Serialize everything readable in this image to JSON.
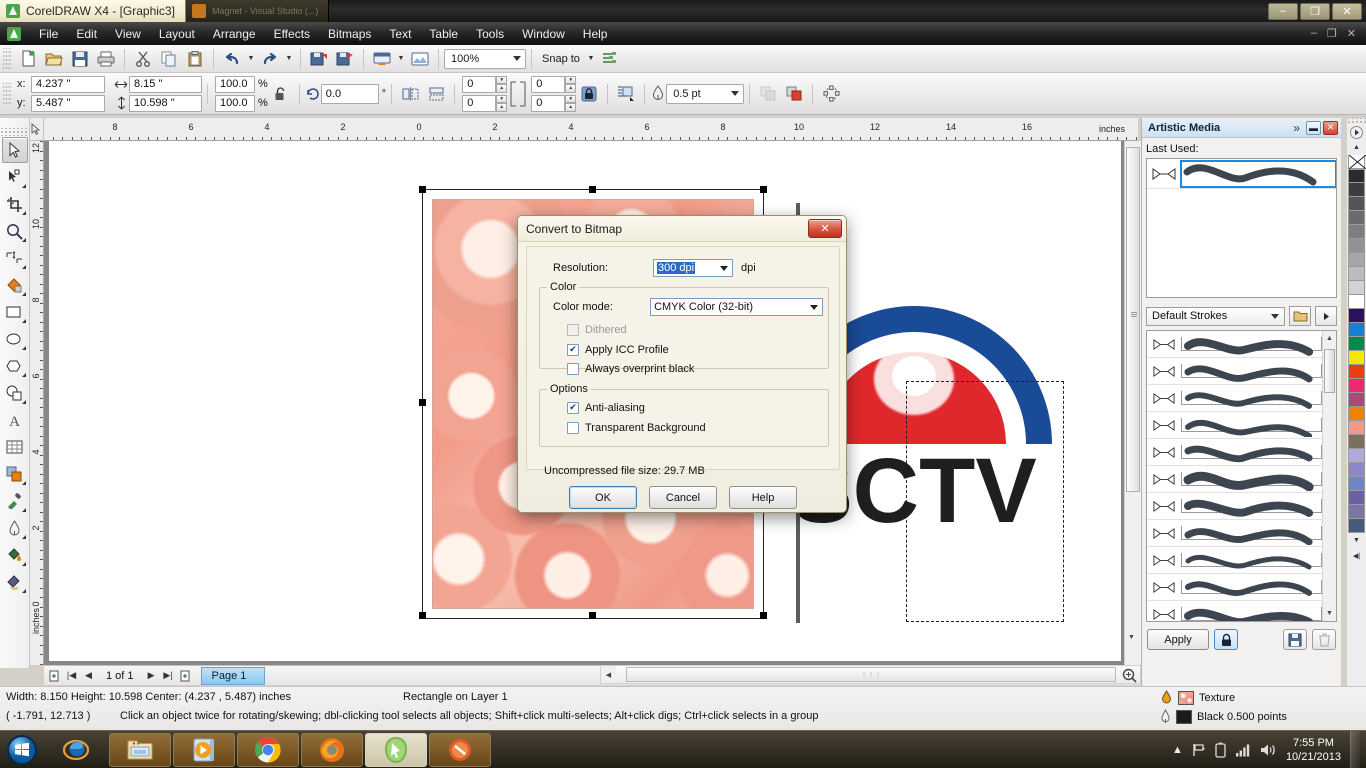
{
  "window": {
    "title": "CorelDRAW X4 - [Graphic3]",
    "ghost_tab": "Magnet - Visual Studio (...)",
    "minimize": "–",
    "restore": "❐",
    "close": "✕",
    "inner_minimize": "–",
    "inner_restore": "❐",
    "inner_close": "✕"
  },
  "menu": {
    "items": [
      {
        "label": "File"
      },
      {
        "label": "Edit"
      },
      {
        "label": "View"
      },
      {
        "label": "Layout"
      },
      {
        "label": "Arrange"
      },
      {
        "label": "Effects"
      },
      {
        "label": "Bitmaps"
      },
      {
        "label": "Text"
      },
      {
        "label": "Table"
      },
      {
        "label": "Tools"
      },
      {
        "label": "Window"
      },
      {
        "label": "Help"
      }
    ]
  },
  "toolbar": {
    "buttons": [
      "new-icon",
      "open-icon",
      "save-icon",
      "print-icon",
      "cut-icon",
      "copy-icon",
      "paste-icon",
      "undo-icon",
      "redo-icon",
      "import-icon",
      "export-icon",
      "application-launcher-icon",
      "corel-connect-icon"
    ],
    "zoom_level": "100%",
    "snap_to": "Snap to",
    "options_icon": "options-icon"
  },
  "propertybar": {
    "x_label": "x:",
    "y_label": "y:",
    "x_value": "4.237 \"",
    "y_value": "5.487 \"",
    "width_value": "8.15 \"",
    "height_value": "10.598 \"",
    "scale_h": "100.0",
    "scale_v": "100.0",
    "percent": "%",
    "lock_ratio_icon": "lock-open-icon",
    "rotation": "0.0",
    "degree": "°",
    "mirror_h_icon": "mirror-horizontal-icon",
    "mirror_v_icon": "mirror-vertical-icon",
    "corner_tl": "0",
    "corner_bl": "0",
    "corner_tr": "0",
    "corner_br": "0",
    "corner_lock_icon": "lock-closed-icon",
    "wrap_icon": "text-wrap-icon",
    "outline_width": "0.5 pt",
    "to_curves_icon": "convert-to-curves-icon"
  },
  "rulers": {
    "unit": "inches",
    "h_ticks": [
      "8",
      "6",
      "4",
      "2",
      "0",
      "2",
      "4",
      "6",
      "8",
      "10",
      "12",
      "14",
      "16"
    ],
    "v_ticks": [
      "12",
      "10",
      "8",
      "6",
      "4",
      "2",
      "0"
    ]
  },
  "toolbox": {
    "tools": [
      {
        "name": "pick-tool",
        "active": true
      },
      {
        "name": "shape-tool",
        "active": false
      },
      {
        "name": "crop-tool",
        "active": false
      },
      {
        "name": "zoom-tool",
        "active": false
      },
      {
        "name": "freehand-tool",
        "active": false
      },
      {
        "name": "smart-fill-tool",
        "active": false
      },
      {
        "name": "rectangle-tool",
        "active": false
      },
      {
        "name": "ellipse-tool",
        "active": false
      },
      {
        "name": "polygon-tool",
        "active": false
      },
      {
        "name": "basic-shapes-tool",
        "active": false
      },
      {
        "name": "text-tool",
        "active": false
      },
      {
        "name": "table-tool",
        "active": false
      },
      {
        "name": "blend-tool",
        "active": false
      },
      {
        "name": "eyedropper-tool",
        "active": false
      },
      {
        "name": "outline-tool",
        "active": false
      },
      {
        "name": "fill-tool",
        "active": false
      },
      {
        "name": "interactive-fill-tool",
        "active": false
      }
    ]
  },
  "docker": {
    "title": "Artistic Media",
    "collapse_icon": "chevrons-right-icon",
    "minimize_icon": "minimize-icon",
    "close_icon": "close-icon",
    "last_used_label": "Last Used:",
    "preset_category": "Default Strokes",
    "folder_icon": "folder-icon",
    "flyout_icon": "flyout-arrow-icon",
    "apply_label": "Apply",
    "lock_icon": "lock-icon",
    "save_icon": "save-icon",
    "delete_icon": "trash-icon",
    "stroke_count": 12
  },
  "palette": {
    "swatches": [
      "#2b2b2b",
      "#3d3d3d",
      "#555555",
      "#6b6b6b",
      "#7e7e7e",
      "#929292",
      "#a6a6a6",
      "#bcbcbc",
      "#d2d2d2",
      "#ffffff",
      "#2d1060",
      "#1680d6",
      "#008a4e",
      "#f5e800",
      "#e8420c",
      "#ec2a6e",
      "#a8497a",
      "#f08000",
      "#f5968a",
      "#7b6f5f",
      "#b1a9da",
      "#8f86c8",
      "#6e84c4",
      "#6d5fa5",
      "#7a76a0",
      "#47597c"
    ],
    "no_color_icon": "no-color-icon",
    "scroll_up_icon": "scroll-up-icon",
    "scroll_down_icon": "scroll-down-icon",
    "expand_icon": "expand-palette-icon"
  },
  "pagenav": {
    "add_page_start_icon": "add-page-icon",
    "first_icon": "first-page-icon",
    "prev_icon": "previous-page-icon",
    "counter": "1 of 1",
    "next_icon": "next-page-icon",
    "last_icon": "last-page-icon",
    "add_page_end_icon": "add-page-icon",
    "tab_label": "Page 1"
  },
  "statusbar": {
    "dimensions": "Width: 8.150  Height: 10.598  Center: (4.237 , 5.487)  inches",
    "object": "Rectangle on Layer 1",
    "cursor": "( -1.791, 12.713 )",
    "hint": "Click an object twice for rotating/skewing; dbl-clicking tool selects all objects; Shift+click multi-selects; Alt+click digs; Ctrl+click selects in a group",
    "fill_label": "Texture",
    "fill_icon": "fill-color-icon",
    "outline_label": "Black  0.500 points",
    "outline_icon": "outline-pen-icon",
    "outline_color": "#1a1a1a"
  },
  "dialog": {
    "title": "Convert to Bitmap",
    "close_label": "✕",
    "resolution_label": "Resolution:",
    "resolution_value": "300 dpi",
    "resolution_unit": "dpi",
    "color_group": "Color",
    "color_mode_label": "Color mode:",
    "color_mode_value": "CMYK Color (32-bit)",
    "dithered_label": "Dithered",
    "dithered_checked": false,
    "dithered_disabled": true,
    "icc_label": "Apply ICC Profile",
    "icc_checked": true,
    "overprint_label": "Always overprint black",
    "overprint_checked": false,
    "options_group": "Options",
    "antialias_label": "Anti-aliasing",
    "antialias_checked": true,
    "transparent_label": "Transparent Background",
    "transparent_checked": false,
    "filesize": "Uncompressed file size: 29.7 MB",
    "ok_label": "OK",
    "cancel_label": "Cancel",
    "help_label": "Help"
  },
  "taskbar": {
    "start_icon": "windows-start-icon",
    "items": [
      {
        "name": "internet-explorer-icon"
      },
      {
        "name": "file-explorer-icon"
      },
      {
        "name": "windows-media-player-icon"
      },
      {
        "name": "google-chrome-icon"
      },
      {
        "name": "firefox-icon"
      },
      {
        "name": "coreldraw-icon"
      },
      {
        "name": "corel-photo-paint-icon"
      }
    ],
    "tray": {
      "show_hidden_icon": "show-hidden-icons-icon",
      "action_center_icon": "flag-icon",
      "battery_icon": "battery-icon",
      "network_icon": "network-signal-icon",
      "volume_icon": "volume-icon"
    },
    "time": "7:55 PM",
    "date": "10/21/2013"
  },
  "artwork": {
    "logo_text": "SCTV",
    "logo_blue": "#1a4b96",
    "logo_red": "#e0282c"
  }
}
